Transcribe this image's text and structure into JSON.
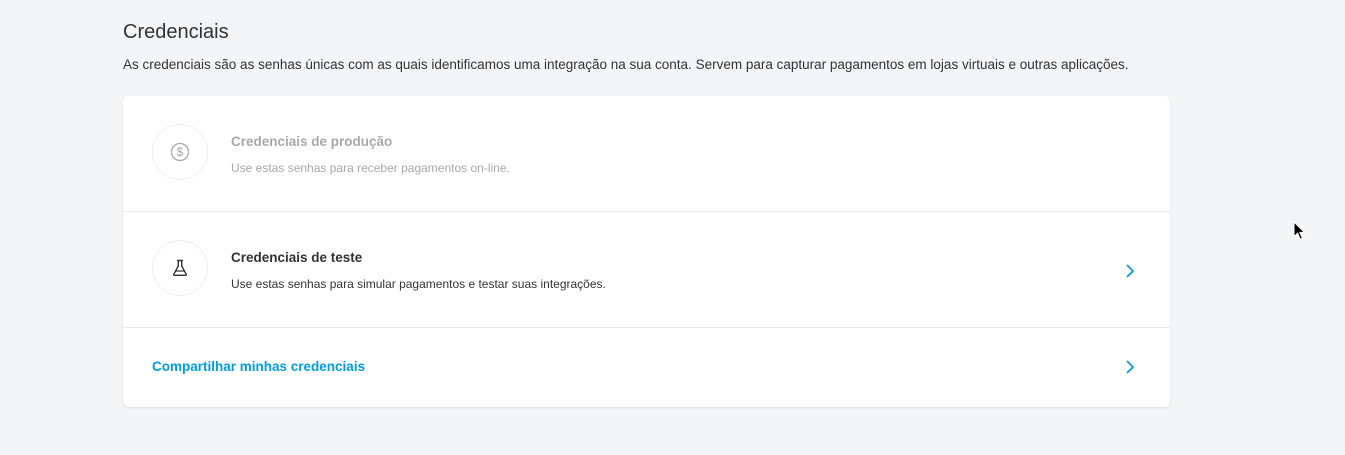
{
  "header": {
    "title": "Credenciais",
    "description": "As credenciais são as senhas únicas com as quais identificamos uma integração na sua conta. Servem para capturar pagamentos em lojas virtuais e outras aplicações."
  },
  "credentials": {
    "production": {
      "icon": "dollar-coin-icon",
      "title": "Credenciais de produção",
      "subtitle": "Use estas senhas para receber pagamentos on-line.",
      "enabled": false
    },
    "test": {
      "icon": "flask-icon",
      "title": "Credenciais de teste",
      "subtitle": "Use estas senhas para simular pagamentos e testar suas integrações.",
      "enabled": true
    },
    "share": {
      "label": "Compartilhar minhas credenciais"
    }
  },
  "colors": {
    "accent": "#009ee3",
    "background": "#f4f5f7",
    "disabled_text": "#a8a8a8"
  }
}
